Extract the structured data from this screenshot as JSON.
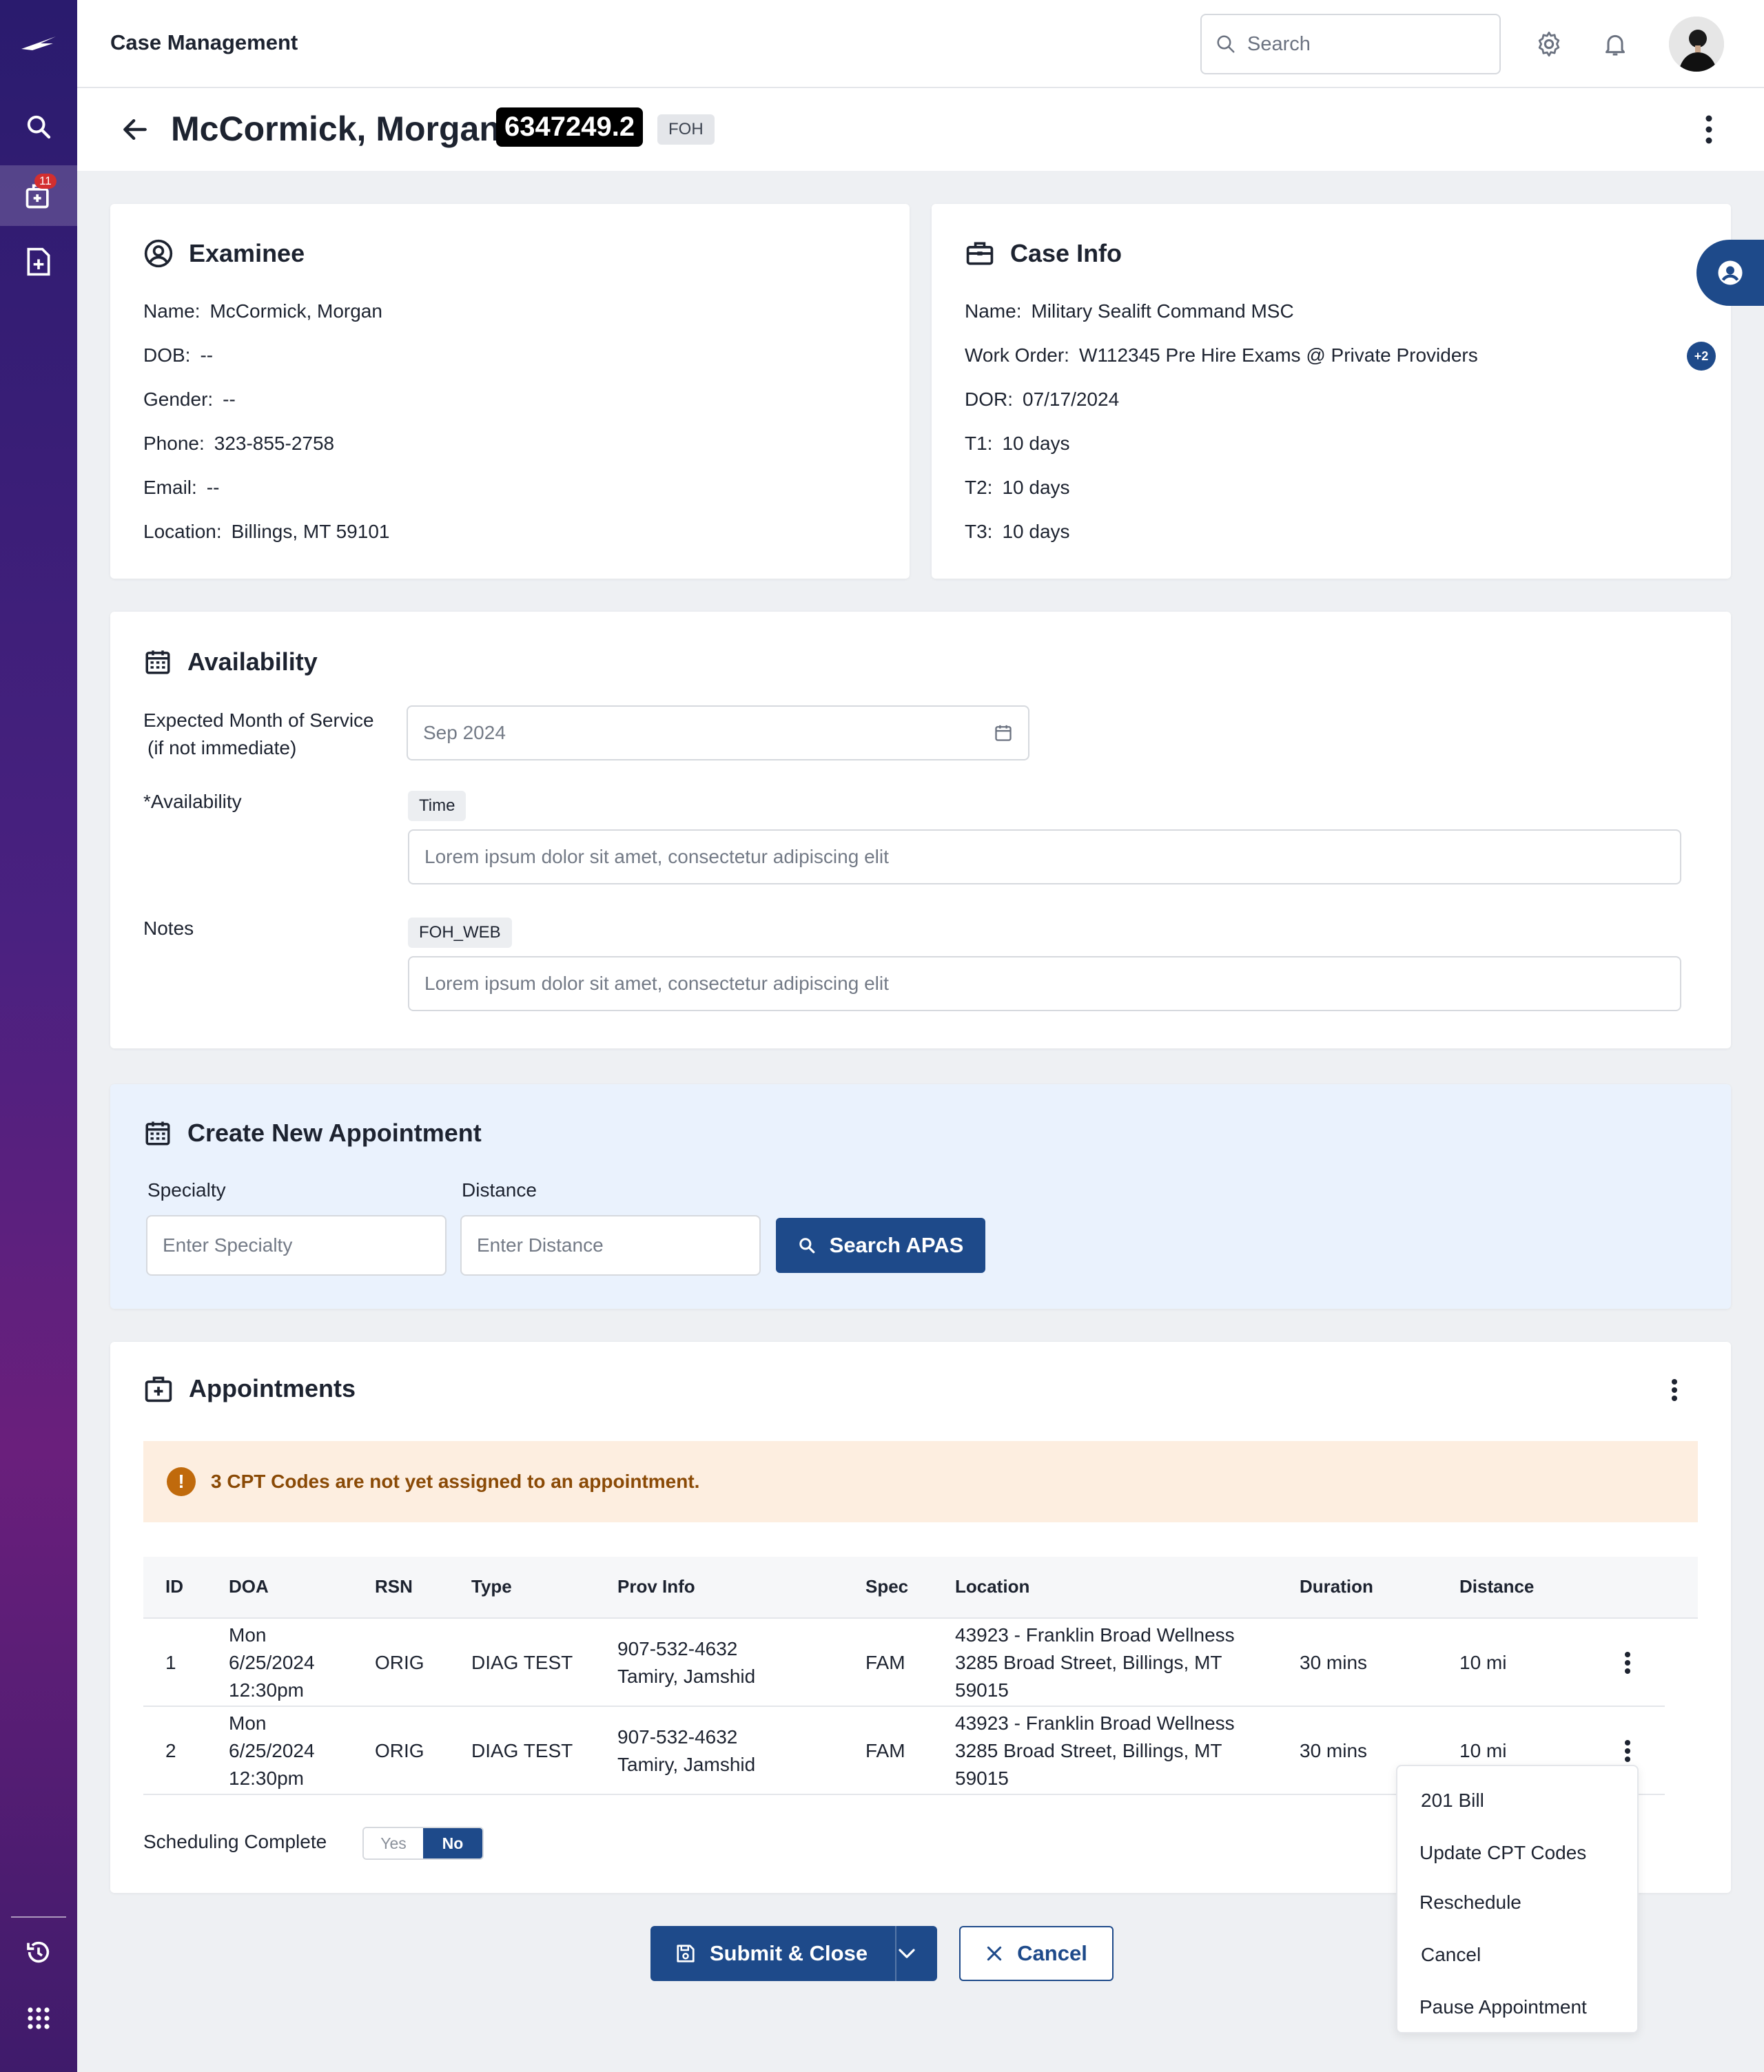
{
  "app": {
    "title": "Case Management"
  },
  "nav": {
    "badge": "11"
  },
  "search": {
    "placeholder": "Search"
  },
  "case": {
    "patient": "McCormick, Morgan",
    "id": "6347249.2",
    "tag": "FOH"
  },
  "examinee": {
    "title": "Examinee",
    "fields": [
      {
        "label": "Name:",
        "value": "McCormick, Morgan"
      },
      {
        "label": "DOB:",
        "value": "--"
      },
      {
        "label": "Gender:",
        "value": "--"
      },
      {
        "label": "Phone:",
        "value": "323-855-2758"
      },
      {
        "label": "Email:",
        "value": "--"
      },
      {
        "label": "Location:",
        "value": "Billings, MT 59101"
      }
    ]
  },
  "case_info": {
    "title": "Case Info",
    "more_badge": "+2",
    "fields": [
      {
        "label": "Name:",
        "value": "Military Sealift Command MSC"
      },
      {
        "label": "Work Order:",
        "value": "W112345 Pre Hire Exams @ Private Providers"
      },
      {
        "label": "DOR:",
        "value": "07/17/2024"
      },
      {
        "label": "T1:",
        "value": "10 days"
      },
      {
        "label": "T2:",
        "value": "10 days"
      },
      {
        "label": "T3:",
        "value": "10 days"
      }
    ]
  },
  "availability": {
    "title": "Availability",
    "month_label_line1": "Expected Month of Service",
    "month_label_line2": "(if not immediate)",
    "month_value": "Sep 2024",
    "avail_label": "*Availability",
    "avail_chip": "Time",
    "avail_placeholder": "Lorem ipsum dolor sit amet, consectetur adipiscing elit",
    "notes_label": "Notes",
    "notes_chip": "FOH_WEB",
    "notes_placeholder": "Lorem ipsum dolor sit amet, consectetur adipiscing elit"
  },
  "create": {
    "title": "Create New Appointment",
    "specialty_label": "Specialty",
    "specialty_placeholder": "Enter Specialty",
    "distance_label": "Distance",
    "distance_placeholder": "Enter Distance",
    "search_button": "Search APAS"
  },
  "appointments": {
    "title": "Appointments",
    "alert": "3 CPT Codes are not yet assigned to an appointment.",
    "columns": [
      "ID",
      "DOA",
      "RSN",
      "Type",
      "Prov Info",
      "Spec",
      "Location",
      "Duration",
      "Distance"
    ],
    "rows": [
      {
        "id": "1",
        "doa": [
          "Mon",
          "6/25/2024",
          "12:30pm"
        ],
        "rsn": "ORIG",
        "type": "DIAG TEST",
        "prov": [
          "907-532-4632",
          "Tamiry, Jamshid"
        ],
        "spec": "FAM",
        "location": [
          "43923 -  Franklin Broad Wellness",
          "3285 Broad Street, Billings, MT",
          "59015"
        ],
        "duration": "30 mins",
        "distance": "10 mi"
      },
      {
        "id": "2",
        "doa": [
          "Mon",
          "6/25/2024",
          "12:30pm"
        ],
        "rsn": "ORIG",
        "type": "DIAG TEST",
        "prov": [
          "907-532-4632",
          "Tamiry, Jamshid"
        ],
        "spec": "FAM",
        "location": [
          "43923 -  Franklin Broad Wellness",
          "3285 Broad Street, Billings, MT",
          "59015"
        ],
        "duration": "30 mins",
        "distance": "10 mi"
      }
    ],
    "scheduling_label": "Scheduling Complete",
    "toggle_yes": "Yes",
    "toggle_no": "No",
    "toggle_selected": "No"
  },
  "row_menu": {
    "items": [
      "201 Bill",
      "Update CPT Codes",
      "Reschedule",
      "Cancel",
      "Pause Appointment"
    ]
  },
  "footer": {
    "submit": "Submit & Close",
    "cancel": "Cancel"
  },
  "colors": {
    "primary": "#1e4a8a",
    "alert_bg": "#fdeee0",
    "alert_text": "#8a4a06",
    "badge": "#d32f2f",
    "nav_top": "#2a1b6e",
    "nav_mid": "#6a1f7c"
  }
}
